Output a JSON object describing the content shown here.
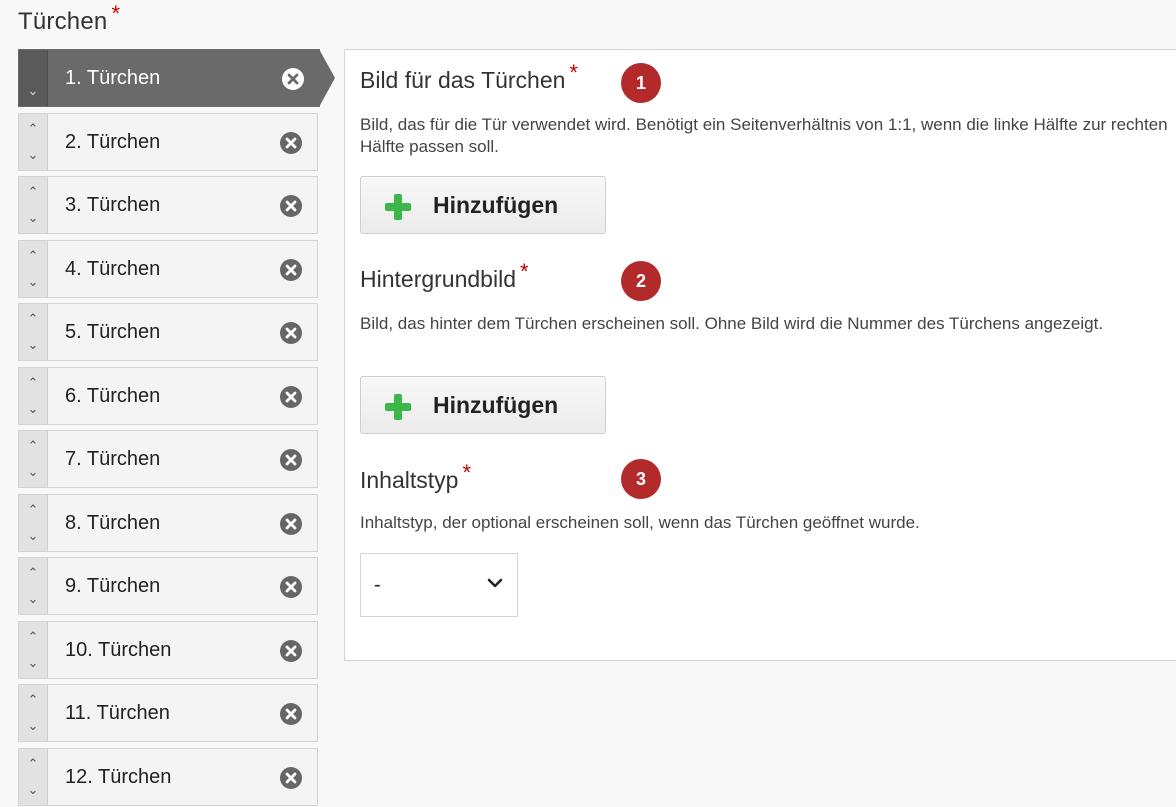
{
  "page": {
    "title": "Türchen",
    "required_mark": "*"
  },
  "doors": [
    {
      "label": "1. Türchen",
      "active": true
    },
    {
      "label": "2. Türchen"
    },
    {
      "label": "3. Türchen"
    },
    {
      "label": "4. Türchen"
    },
    {
      "label": "5. Türchen"
    },
    {
      "label": "6. Türchen"
    },
    {
      "label": "7. Türchen"
    },
    {
      "label": "8. Türchen"
    },
    {
      "label": "9. Türchen"
    },
    {
      "label": "10. Türchen"
    },
    {
      "label": "11. Türchen"
    },
    {
      "label": "12. Türchen"
    }
  ],
  "icons": {
    "move_up": "chevron-up-icon",
    "move_down": "chevron-down-icon",
    "remove": "close-circle-icon",
    "add": "plus-icon",
    "select": "chevron-down-icon"
  },
  "fields": {
    "image": {
      "label": "Bild für das Türchen",
      "required_mark": "*",
      "badge": "1",
      "description": "Bild, das für die Tür verwendet wird. Benötigt ein Seitenverhältnis von 1:1, wenn die linke Hälfte zur rechten Hälfte passen soll.",
      "button_label": "Hinzufügen"
    },
    "background": {
      "label": "Hintergrundbild",
      "required_mark": "*",
      "badge": "2",
      "description": "Bild, das hinter dem Türchen erscheinen soll. Ohne Bild wird die Nummer des Türchens angezeigt.",
      "button_label": "Hinzufügen"
    },
    "content_type": {
      "label": "Inhaltstyp",
      "required_mark": "*",
      "badge": "3",
      "description": "Inhaltstyp, der optional erscheinen soll, wenn das Türchen geöffnet wurde.",
      "selected": "-"
    }
  },
  "colors": {
    "accent_badge": "#b22a2a",
    "required": "#c00000",
    "add_icon": "#3cb648",
    "active_item": "#6a6a6a"
  }
}
